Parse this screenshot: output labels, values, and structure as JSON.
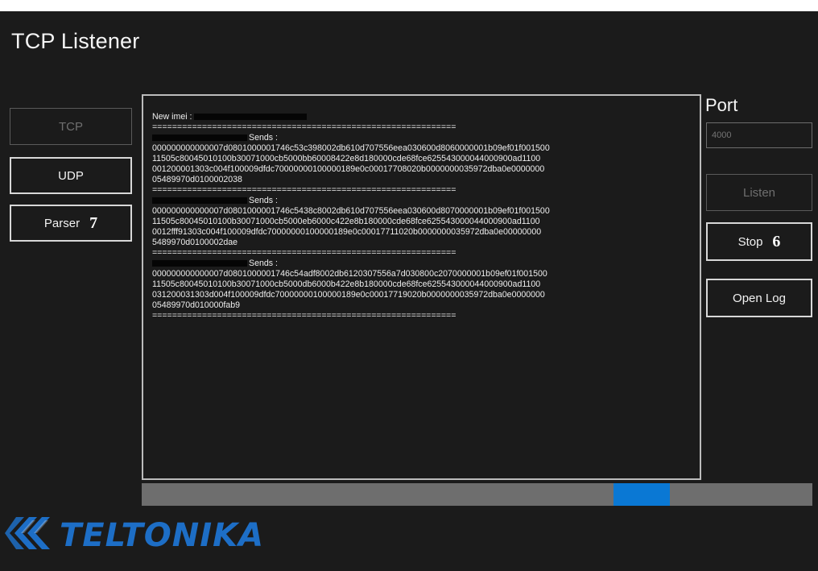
{
  "window": {
    "title": "TCP Listener"
  },
  "sidebar": {
    "tcp_label": "TCP",
    "udp_label": "UDP",
    "parser_label": "Parser",
    "parser_callout": "7"
  },
  "log": {
    "lines": [
      "New imei :",
      "=============================================================",
      "Sends :",
      "000000000000007d0801000001746c53c398002db610d707556eea030600d8060000001b09ef01f001500",
      "11505c80045010100b30071000cb5000bb60008422e8d180000cde68fce625543000044000900ad1100",
      "001200001303c004f100009dfdc70000000100000189e0c00017708020b0000000035972dba0e0000000",
      "05489970d0100002038",
      "=============================================================",
      "Sends :",
      "000000000000007d0801000001746c5438c8002db610d707556eea030600d8070000001b09ef01f001500",
      "11505c80045010100b30071000cb5000eb6000c422e8b180000cde68fce625543000044000900ad1100",
      "0012fff91303c004f100009dfdc70000000100000189e0c00017711020b0000000035972dba0e00000000",
      "5489970d0100002dae",
      "=============================================================",
      "Sends :",
      "000000000000007d0801000001746c54adf8002db6120307556a7d030800c2070000001b09ef01f001500",
      "11505c80045010100b30071000cb5000db6000b422e8b180000cde68fce625543000044000900ad1100",
      "031200031303d004f100009dfdc70000000100000189e0c00017719020b0000000035972dba0e0000000",
      "05489970d010000fab9",
      "============================================================="
    ]
  },
  "port": {
    "label": "Port",
    "placeholder": "4000",
    "value": ""
  },
  "actions": {
    "listen_label": "Listen",
    "stop_label": "Stop",
    "stop_callout": "6",
    "open_log_label": "Open Log"
  },
  "progress": {
    "state": "indeterminate",
    "color": "#0a78d4"
  },
  "logo": {
    "text": "TELTONIKA",
    "color": "#1d6ec6",
    "icon": "teltonika-chevrons-icon"
  },
  "colors": {
    "background": "#1b1b1b",
    "text": "#f2f2f2",
    "disabled_text": "#6f6f6f",
    "progress_track": "#6e6e6e"
  }
}
